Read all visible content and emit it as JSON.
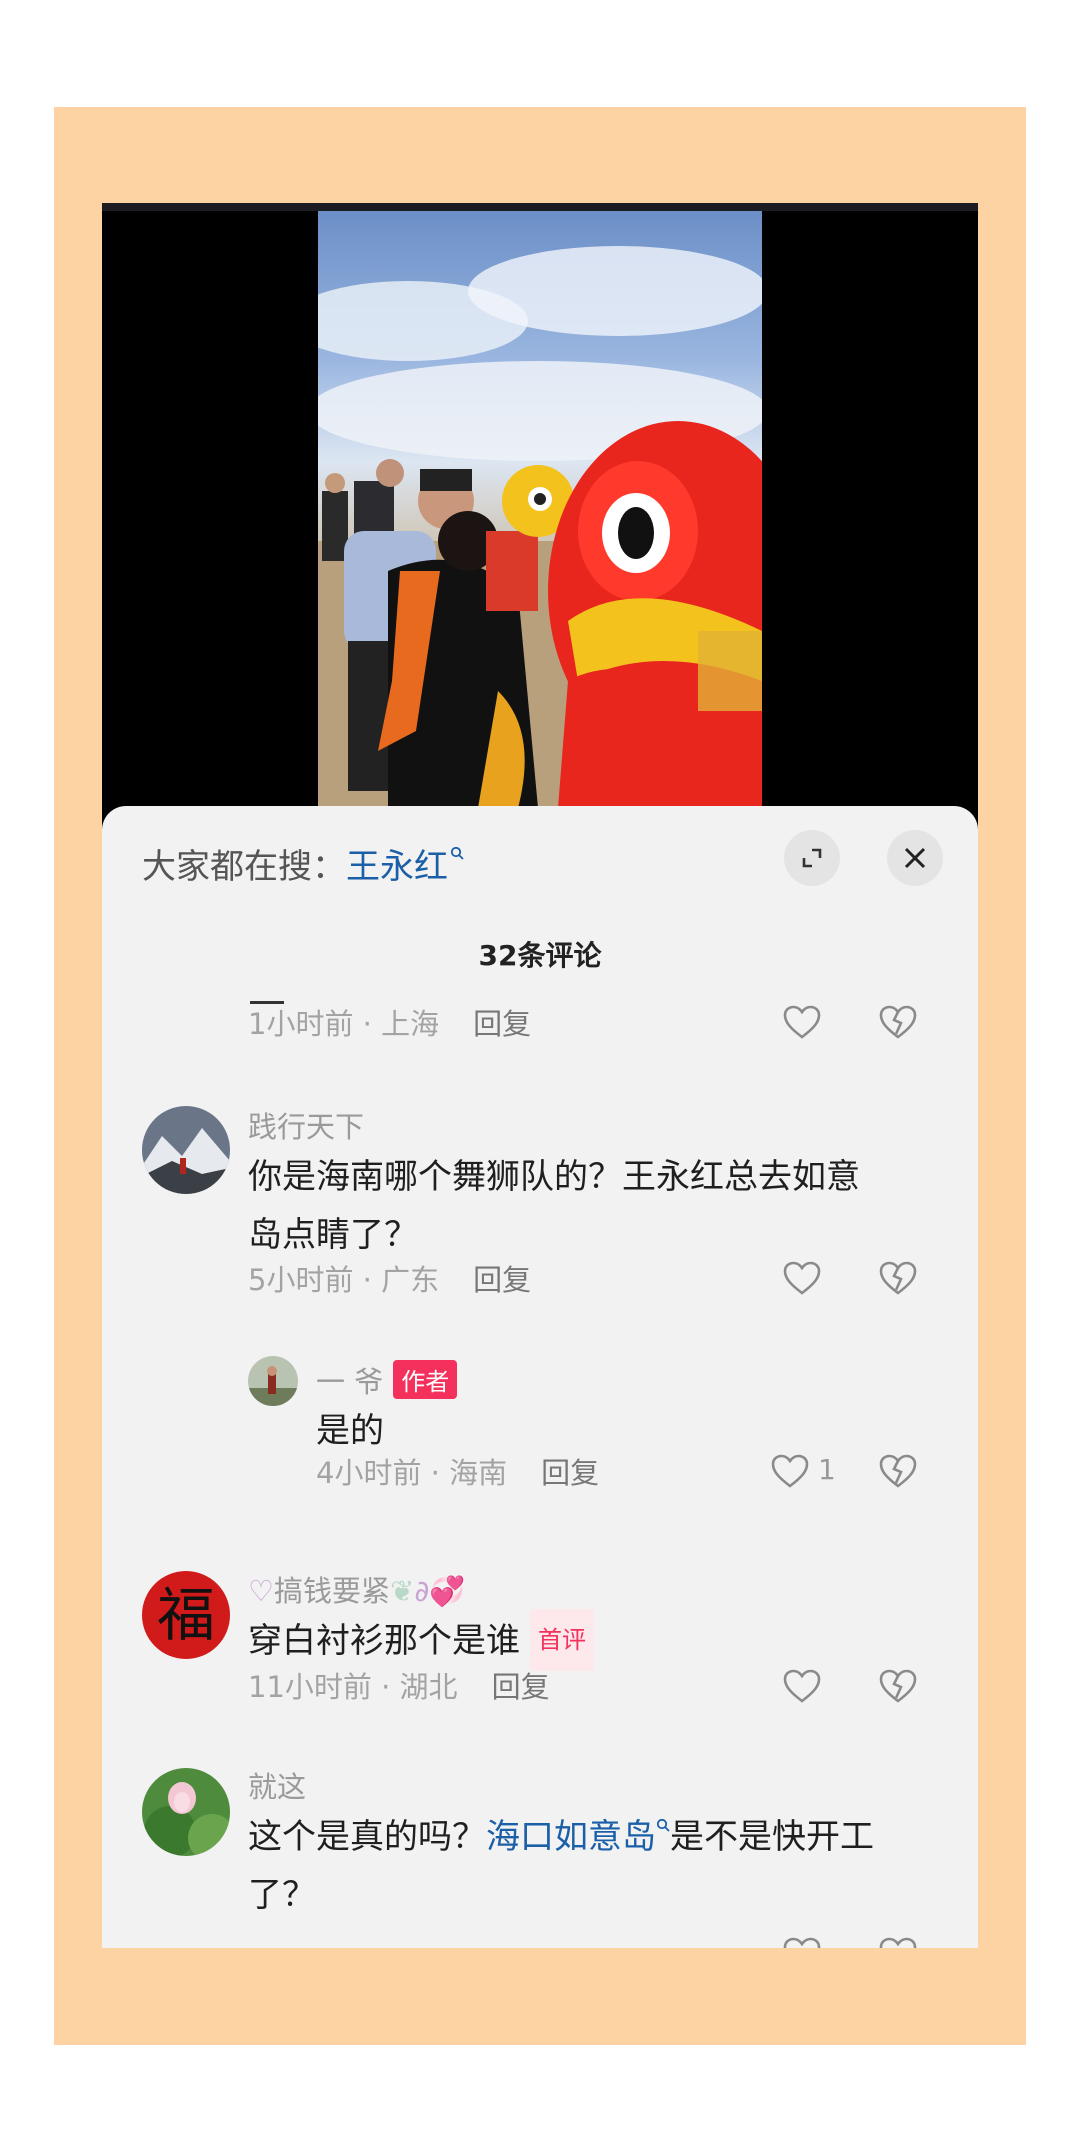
{
  "search": {
    "prefix": "大家都在搜：",
    "term": "王永红"
  },
  "comments_header": {
    "count_label": "32条评论"
  },
  "comments": [
    {
      "id": "c0",
      "meta": "1小时前 · 上海",
      "reply": "回复"
    },
    {
      "id": "c1",
      "user": "践行天下",
      "text": "你是海南哪个舞狮队的？王永红总去如意岛点睛了？",
      "meta": "5小时前 · 广东",
      "reply": "回复",
      "replies": [
        {
          "user": "一 爷",
          "tag": "作者",
          "text": "是的",
          "meta": "4小时前 · 海南",
          "reply": "回复",
          "likes": "1"
        }
      ]
    },
    {
      "id": "c2",
      "user": "搞钱要紧",
      "avatar_char": "福",
      "text": "穿白衬衫那个是谁",
      "tag": "首评",
      "meta": "11小时前 · 湖北",
      "reply": "回复"
    },
    {
      "id": "c3",
      "user": "就这",
      "text_before": "这个是真的吗？",
      "text_link": "海口如意岛",
      "text_after": "是不是快开工了？"
    }
  ],
  "colors": {
    "frame": "#fdd3a4",
    "accent_link": "#1b5fa8",
    "author_tag": "#f4315c"
  },
  "icons": [
    "search-mini-icon",
    "expand-icon",
    "close-icon",
    "heart-icon",
    "dislike-icon"
  ]
}
